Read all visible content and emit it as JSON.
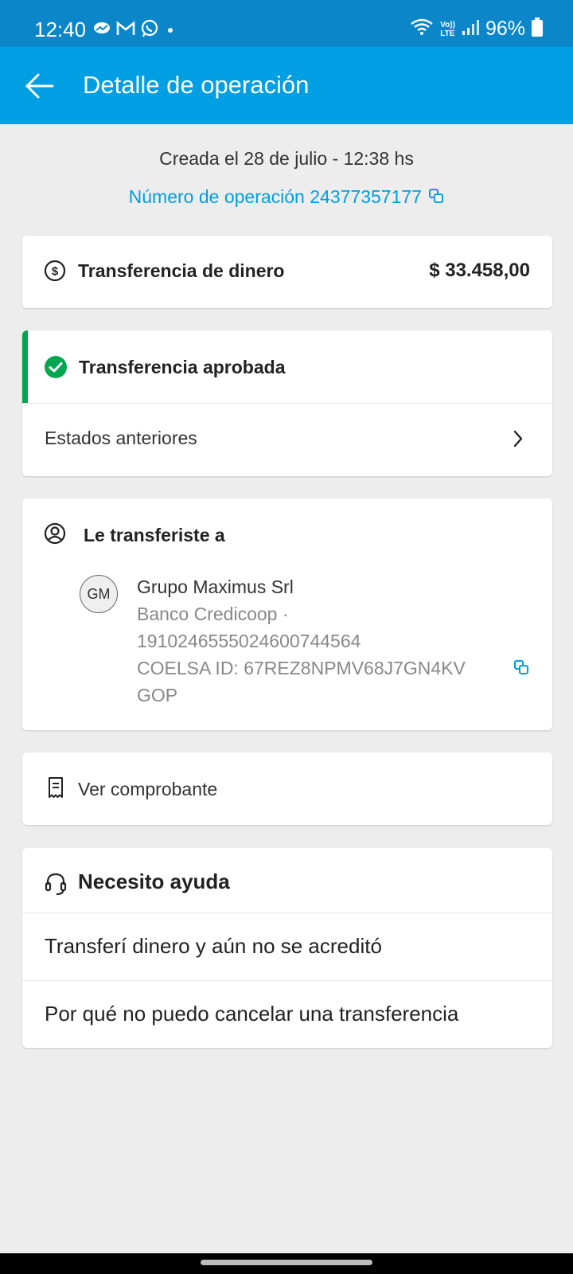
{
  "status_bar": {
    "time": "12:40",
    "battery": "96%",
    "left_icons": [
      "messenger-icon",
      "gmail-icon",
      "whatsapp-icon",
      "dot-icon"
    ],
    "right_icons": [
      "wifi-icon",
      "volte-icon",
      "signal-icon",
      "battery-icon"
    ],
    "volte_label_top": "Vo))",
    "volte_label_bottom": "LTE"
  },
  "app_bar": {
    "title": "Detalle de operación",
    "back_icon": "arrow-left-icon"
  },
  "header": {
    "created": "Creada el 28 de julio - 12:38 hs",
    "operation_number": "Número de operación 24377357177"
  },
  "summary": {
    "title": "Transferencia de dinero",
    "amount": "$ 33.458,00"
  },
  "status": {
    "title": "Transferencia aprobada",
    "previous_label": "Estados anteriores"
  },
  "recipient": {
    "title": "Le transferiste a",
    "initials": "GM",
    "name": "Grupo Maximus Srl",
    "bank_line": "Banco Credicoop ·",
    "account": "1910246555024600744564",
    "coelsa": "COELSA ID: 67REZ8NPMV68J7GN4KV",
    "coelsa_cont": "GOP"
  },
  "receipt": {
    "label": "Ver comprobante"
  },
  "help": {
    "title": "Necesito ayuda",
    "items": [
      "Transferí dinero y aún no se acreditó",
      "Por qué no puedo cancelar una transferencia"
    ]
  },
  "colors": {
    "status_bar": "#0b86c9",
    "app_bar": "#009ee3",
    "link": "#009ee3",
    "success": "#00a650",
    "background": "#ededed"
  }
}
